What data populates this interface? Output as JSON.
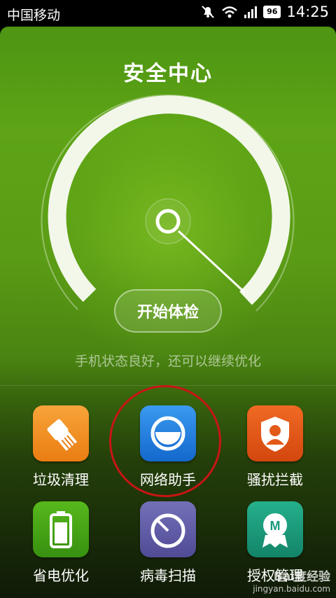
{
  "statusbar": {
    "carrier": "中国移动",
    "battery": "96",
    "time": "14:25"
  },
  "header": {
    "title": "安全中心"
  },
  "scan": {
    "button_label": "开始体检",
    "status_text": "手机状态良好，还可以继续优化"
  },
  "tools": [
    {
      "label": "垃圾清理",
      "icon": "broom-icon",
      "color": "#f08c22"
    },
    {
      "label": "网络助手",
      "icon": "network-icon",
      "color": "#1e7fe0"
    },
    {
      "label": "骚扰拦截",
      "icon": "shield-icon",
      "color": "#e35a18"
    },
    {
      "label": "省电优化",
      "icon": "battery-icon",
      "color": "#43a012"
    },
    {
      "label": "病毒扫描",
      "icon": "virus-scan-icon",
      "color": "#5e5aa5"
    },
    {
      "label": "授权管理",
      "icon": "badge-icon",
      "color": "#1a9a7a"
    }
  ],
  "watermark": {
    "logo": "Bai度经验",
    "url": "jingyan.baidu.com"
  }
}
